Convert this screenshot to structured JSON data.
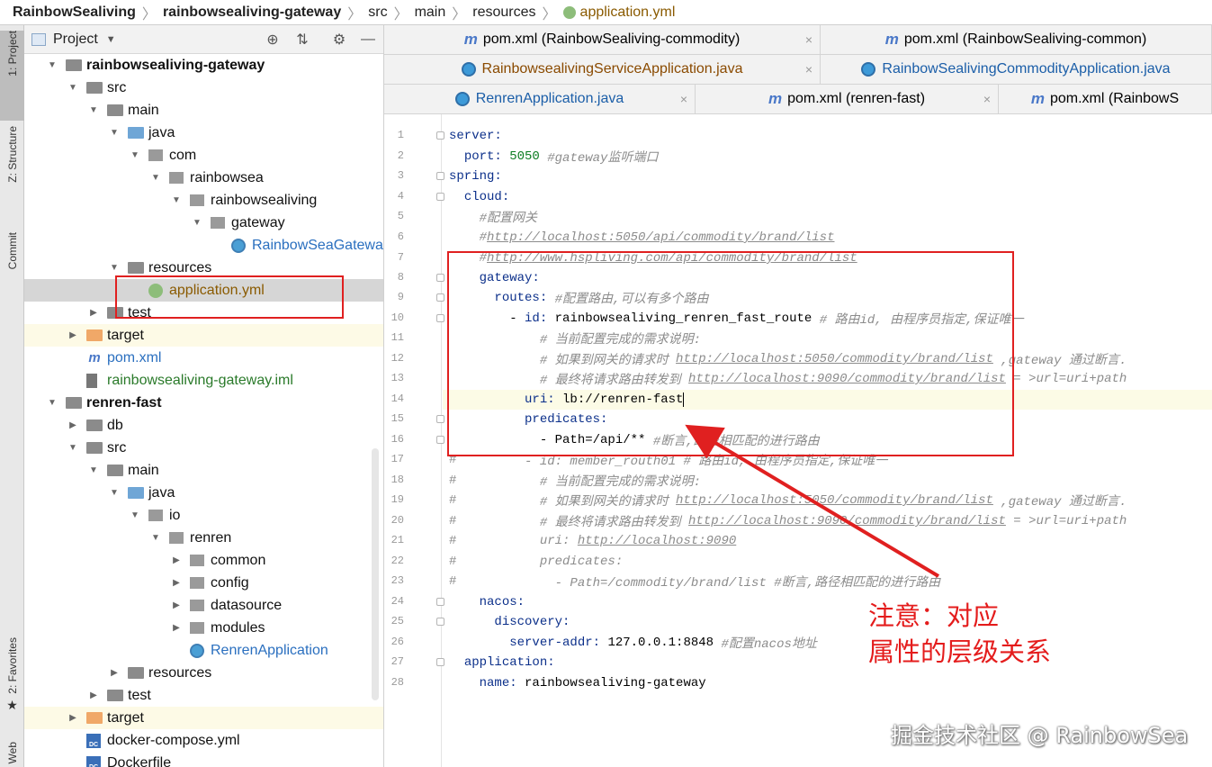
{
  "breadcrumb": [
    "RainbowSealiving",
    "rainbowsealiving-gateway",
    "src",
    "main",
    "resources",
    "application.yml"
  ],
  "sidebar": {
    "tabs": [
      "1: Project",
      "Z: Structure",
      "Commit",
      "2: Favorites",
      "Web"
    ]
  },
  "project_panel": {
    "title": "Project",
    "tree": [
      {
        "label": "rainbowsealiving-gateway",
        "indent": 0,
        "expanded": true,
        "icon": "module-folder",
        "bold": true
      },
      {
        "label": "src",
        "indent": 1,
        "expanded": true,
        "icon": "folder"
      },
      {
        "label": "main",
        "indent": 2,
        "expanded": true,
        "icon": "folder"
      },
      {
        "label": "java",
        "indent": 3,
        "expanded": true,
        "icon": "source-folder"
      },
      {
        "label": "com",
        "indent": 4,
        "expanded": true,
        "icon": "package"
      },
      {
        "label": "rainbowsea",
        "indent": 5,
        "expanded": true,
        "icon": "package"
      },
      {
        "label": "rainbowsealiving",
        "indent": 6,
        "expanded": true,
        "icon": "package"
      },
      {
        "label": "gateway",
        "indent": 7,
        "expanded": true,
        "icon": "package"
      },
      {
        "label": "RainbowSeaGateway",
        "indent": 8,
        "icon": "spring-class",
        "color": "#2a6fbf"
      },
      {
        "label": "resources",
        "indent": 3,
        "expanded": true,
        "icon": "resources-folder"
      },
      {
        "label": "application.yml",
        "indent": 4,
        "icon": "yml-file",
        "color": "#8a5a00",
        "selected": true
      },
      {
        "label": "test",
        "indent": 2,
        "expanded": false,
        "icon": "folder"
      },
      {
        "label": "target",
        "indent": 1,
        "expanded": false,
        "icon": "excluded-folder",
        "excluded": true
      },
      {
        "label": "pom.xml",
        "indent": 1,
        "icon": "maven-file",
        "color": "#2a6fbf"
      },
      {
        "label": "rainbowsealiving-gateway.iml",
        "indent": 1,
        "icon": "iml-file",
        "color": "#2a7a2a"
      },
      {
        "label": "renren-fast",
        "indent": 0,
        "expanded": true,
        "icon": "module-folder",
        "bold": true
      },
      {
        "label": "db",
        "indent": 1,
        "expanded": false,
        "icon": "folder"
      },
      {
        "label": "src",
        "indent": 1,
        "expanded": true,
        "icon": "folder"
      },
      {
        "label": "main",
        "indent": 2,
        "expanded": true,
        "icon": "folder"
      },
      {
        "label": "java",
        "indent": 3,
        "expanded": true,
        "icon": "source-folder"
      },
      {
        "label": "io",
        "indent": 4,
        "expanded": true,
        "icon": "package"
      },
      {
        "label": "renren",
        "indent": 5,
        "expanded": true,
        "icon": "package"
      },
      {
        "label": "common",
        "indent": 6,
        "expanded": false,
        "icon": "package"
      },
      {
        "label": "config",
        "indent": 6,
        "expanded": false,
        "icon": "package"
      },
      {
        "label": "datasource",
        "indent": 6,
        "expanded": false,
        "icon": "package"
      },
      {
        "label": "modules",
        "indent": 6,
        "expanded": false,
        "icon": "package"
      },
      {
        "label": "RenrenApplication",
        "indent": 6,
        "icon": "spring-class",
        "color": "#2a6fbf"
      },
      {
        "label": "resources",
        "indent": 3,
        "expanded": false,
        "icon": "resources-folder"
      },
      {
        "label": "test",
        "indent": 2,
        "expanded": false,
        "icon": "folder"
      },
      {
        "label": "target",
        "indent": 1,
        "expanded": false,
        "icon": "excluded-folder",
        "excluded": true
      },
      {
        "label": "docker-compose.yml",
        "indent": 1,
        "icon": "docker-file"
      },
      {
        "label": "Dockerfile",
        "indent": 1,
        "icon": "docker-file"
      }
    ]
  },
  "editor_tabs": [
    {
      "label": "pom.xml (RainbowSealiving-commodity)",
      "icon": "maven-icon",
      "row": 0
    },
    {
      "label": "pom.xml (RainbowSealiving-common)",
      "icon": "maven-icon",
      "row": 0
    },
    {
      "label": "RainbowsealivingServiceApplication.java",
      "icon": "spring-class-icon",
      "row": 1
    },
    {
      "label": "RainbowSealivingCommodityApplication.java",
      "icon": "spring-class-icon",
      "row": 1
    },
    {
      "label": "RenrenApplication.java",
      "icon": "spring-class-icon",
      "row": 2
    },
    {
      "label": "pom.xml (renren-fast)",
      "icon": "maven-icon",
      "row": 2
    },
    {
      "label": "pom.xml (RainbowS",
      "icon": "maven-icon",
      "row": 2
    }
  ],
  "code_lines": [
    {
      "n": "1",
      "parts": [
        [
          "key",
          "server:"
        ]
      ]
    },
    {
      "n": "2",
      "parts": [
        [
          "plain",
          "  "
        ],
        [
          "key",
          "port:"
        ],
        [
          "val",
          " 5050 "
        ],
        [
          "comment",
          "#gateway监听端口"
        ]
      ]
    },
    {
      "n": "3",
      "parts": [
        [
          "key",
          "spring:"
        ]
      ]
    },
    {
      "n": "4",
      "parts": [
        [
          "plain",
          "  "
        ],
        [
          "key",
          "cloud:"
        ]
      ]
    },
    {
      "n": "5",
      "parts": [
        [
          "plain",
          "    "
        ],
        [
          "comment",
          "#配置网关"
        ]
      ]
    },
    {
      "n": "6",
      "parts": [
        [
          "plain",
          "    "
        ],
        [
          "comment",
          "#"
        ],
        [
          "link",
          "http://localhost:5050/api/commodity/brand/list"
        ]
      ]
    },
    {
      "n": "7",
      "parts": [
        [
          "plain",
          "    "
        ],
        [
          "comment",
          "#"
        ],
        [
          "link",
          "http://www.hspliving.com/api/commodity/brand/list"
        ]
      ]
    },
    {
      "n": "8",
      "parts": [
        [
          "plain",
          "    "
        ],
        [
          "key",
          "gateway:"
        ]
      ]
    },
    {
      "n": "9",
      "parts": [
        [
          "plain",
          "      "
        ],
        [
          "key",
          "routes:"
        ],
        [
          "plain",
          " "
        ],
        [
          "comment",
          "#配置路由,可以有多个路由"
        ]
      ]
    },
    {
      "n": "10",
      "parts": [
        [
          "plain",
          "        - "
        ],
        [
          "key",
          "id:"
        ],
        [
          "plain",
          " rainbowsealiving_renren_fast_route "
        ],
        [
          "comment",
          "# 路由id, 由程序员指定,保证唯一"
        ]
      ]
    },
    {
      "n": "11",
      "parts": [
        [
          "plain",
          "            "
        ],
        [
          "comment",
          "# 当前配置完成的需求说明:"
        ]
      ]
    },
    {
      "n": "12",
      "parts": [
        [
          "plain",
          "            "
        ],
        [
          "comment",
          "# 如果到网关的请求时 "
        ],
        [
          "link",
          "http://localhost:5050/commodity/brand/list"
        ],
        [
          "comment",
          " ,gateway 通过断言."
        ]
      ]
    },
    {
      "n": "13",
      "parts": [
        [
          "plain",
          "            "
        ],
        [
          "comment",
          "# 最终将请求路由转发到 "
        ],
        [
          "link",
          "http://localhost:9090/commodity/brand/list"
        ],
        [
          "comment",
          " = >url=uri+path"
        ]
      ]
    },
    {
      "n": "14",
      "current": true,
      "parts": [
        [
          "plain",
          "          "
        ],
        [
          "key",
          "uri:"
        ],
        [
          "plain",
          " lb://renren-fast"
        ]
      ]
    },
    {
      "n": "15",
      "parts": [
        [
          "plain",
          "          "
        ],
        [
          "key",
          "predicates:"
        ]
      ]
    },
    {
      "n": "16",
      "parts": [
        [
          "plain",
          "            - Path=/api/** "
        ],
        [
          "comment",
          "#断言,路径相匹配的进行路由"
        ]
      ]
    },
    {
      "n": "17",
      "parts": [
        [
          "hash",
          "#"
        ],
        [
          "comment",
          "         - id: member_routh01 # 路由id, 由程序员指定,保证唯一"
        ]
      ]
    },
    {
      "n": "18",
      "parts": [
        [
          "hash",
          "#"
        ],
        [
          "comment",
          "           # 当前配置完成的需求说明:"
        ]
      ]
    },
    {
      "n": "19",
      "parts": [
        [
          "hash",
          "#"
        ],
        [
          "comment",
          "           # 如果到网关的请求时 "
        ],
        [
          "link",
          "http://localhost:5050/commodity/brand/list"
        ],
        [
          "comment",
          " ,gateway 通过断言."
        ]
      ]
    },
    {
      "n": "20",
      "parts": [
        [
          "hash",
          "#"
        ],
        [
          "comment",
          "           # 最终将请求路由转发到 "
        ],
        [
          "link",
          "http://localhost:9090/commodity/brand/list"
        ],
        [
          "comment",
          " = >url=uri+path"
        ]
      ]
    },
    {
      "n": "21",
      "parts": [
        [
          "hash",
          "#"
        ],
        [
          "comment",
          "           uri: "
        ],
        [
          "link",
          "http://localhost:9090"
        ]
      ]
    },
    {
      "n": "22",
      "parts": [
        [
          "hash",
          "#"
        ],
        [
          "comment",
          "           predicates:"
        ]
      ]
    },
    {
      "n": "23",
      "parts": [
        [
          "hash",
          "#"
        ],
        [
          "comment",
          "             - Path=/commodity/brand/list #断言,路径相匹配的进行路由"
        ]
      ]
    },
    {
      "n": "24",
      "parts": [
        [
          "plain",
          "    "
        ],
        [
          "key",
          "nacos:"
        ]
      ]
    },
    {
      "n": "25",
      "parts": [
        [
          "plain",
          "      "
        ],
        [
          "key",
          "discovery:"
        ]
      ]
    },
    {
      "n": "26",
      "parts": [
        [
          "plain",
          "        "
        ],
        [
          "key",
          "server-addr:"
        ],
        [
          "plain",
          " 127.0.0.1:8848 "
        ],
        [
          "comment",
          "#配置nacos地址"
        ]
      ]
    },
    {
      "n": "27",
      "parts": [
        [
          "plain",
          "  "
        ],
        [
          "key",
          "application:"
        ]
      ]
    },
    {
      "n": "28",
      "parts": [
        [
          "plain",
          "    "
        ],
        [
          "key",
          "name:"
        ],
        [
          "plain",
          " rainbowsealiving-gateway"
        ]
      ]
    }
  ],
  "annotation": {
    "line1": "注意：对应",
    "line2": "属性的层级关系"
  },
  "watermark": "掘金技术社区 @ RainbowSea",
  "colors": {
    "annotation_red": "#e02020",
    "key_blue": "#0b2f8a",
    "comment_gray": "#8c8c8c",
    "selected_row": "#d6d6d6"
  }
}
